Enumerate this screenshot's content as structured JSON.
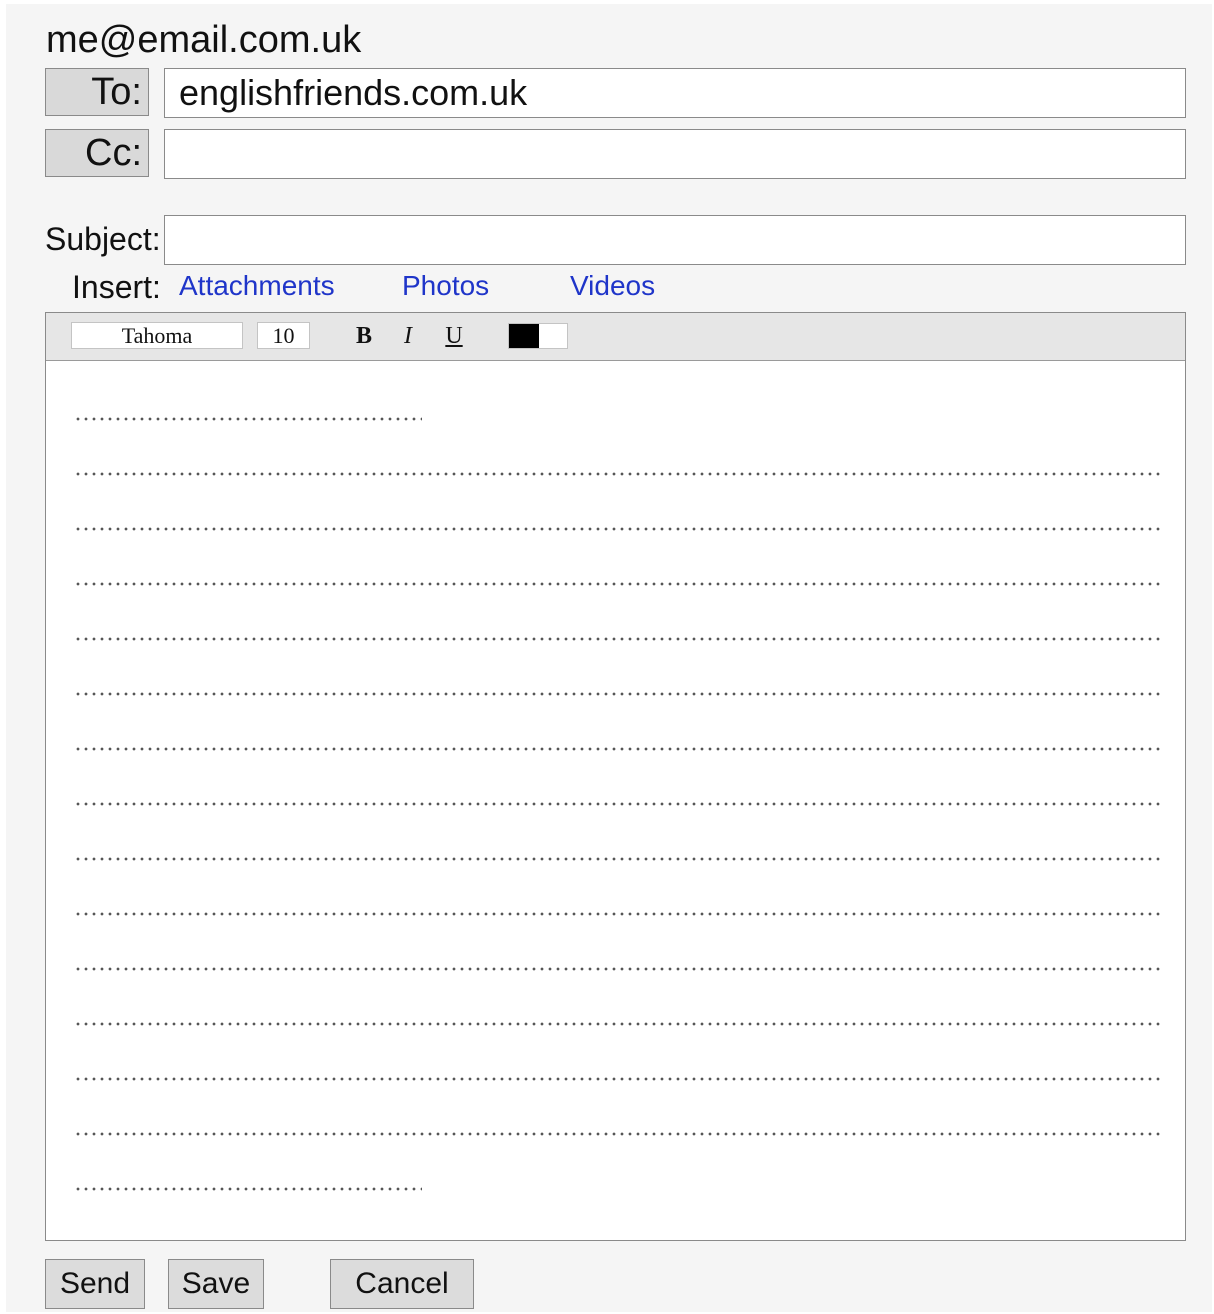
{
  "compose": {
    "from": "me@email.com.uk",
    "to_label": "To:",
    "to_value": "englishfriends.com.uk",
    "cc_label": "Cc:",
    "cc_value": "",
    "subject_label": "Subject:",
    "subject_value": "",
    "insert_label": "Insert:",
    "insert_links": [
      "Attachments",
      "Photos",
      "Videos"
    ]
  },
  "toolbar": {
    "font": "Tahoma",
    "size": "10",
    "bold": "B",
    "italic": "I",
    "underline": "U",
    "text_color": "#000000"
  },
  "actions": {
    "send": "Send",
    "save": "Save",
    "cancel": "Cancel"
  },
  "colors": {
    "link": "#1f35c9",
    "panel_bg": "#f5f5f5",
    "button_bg": "#d9d9d9"
  }
}
